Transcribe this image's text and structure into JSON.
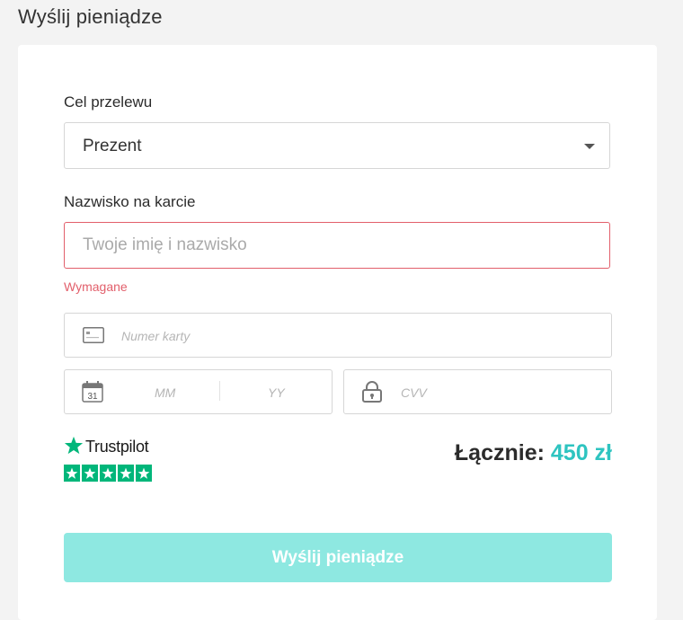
{
  "page": {
    "title": "Wyślij pieniądze"
  },
  "form": {
    "purpose": {
      "label": "Cel przelewu",
      "value": "Prezent"
    },
    "name": {
      "label": "Nazwisko na karcie",
      "placeholder": "Twoje imię i nazwisko",
      "value": "",
      "error": "Wymagane"
    },
    "card_number": {
      "placeholder": "Numer karty"
    },
    "expiry": {
      "month_placeholder": "MM",
      "year_placeholder": "YY",
      "calendar_day": "31"
    },
    "cvv": {
      "placeholder": "CVV"
    }
  },
  "trustpilot": {
    "name": "Trustpilot",
    "stars": 5,
    "color": "#00b67a"
  },
  "total": {
    "label": "Łącznie:",
    "amount": "450 zł"
  },
  "submit": {
    "label": "Wyślij pieniądze"
  },
  "colors": {
    "accent": "#2ec4c0",
    "button": "#8ee8e1",
    "error": "#e25f6b"
  }
}
